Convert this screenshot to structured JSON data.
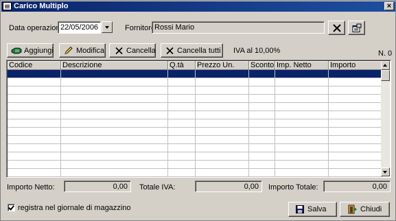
{
  "window": {
    "title": "Carico Multiplo",
    "close_label": "×"
  },
  "header": {
    "date_label": "Data operazione:",
    "date_value": "22/05/2006",
    "supplier_label": "Fornitore:",
    "supplier_value": "Rossi Mario"
  },
  "toolbar": {
    "add_label": "Aggiungi",
    "edit_label": "Modifica",
    "delete_label": "Cancella",
    "delete_all_label": "Cancella tutti",
    "vat_info": "IVA al 10,00%",
    "count": "N. 0"
  },
  "grid": {
    "columns": [
      "Codice",
      "Descrizione",
      "Q.tà",
      "Prezzo Un.",
      "Sconto",
      "Imp. Netto",
      "Importo"
    ],
    "rows": []
  },
  "totals": {
    "net_label": "Importo Netto:",
    "net_value": "0,00",
    "vat_label": "Totale IVA:",
    "vat_value": "0,00",
    "total_label": "Importo Totale:",
    "total_value": "0,00"
  },
  "footer": {
    "register_label": "registra nel giornale di magazzino",
    "register_checked": true,
    "save_label": "Salva",
    "close_label": "Chiudi"
  },
  "icons": {
    "app": "document-icon",
    "add": "add-hand-icon",
    "edit": "pencil-icon",
    "delete": "x-icon",
    "delete_all": "x-icon",
    "clear_supplier": "x-icon",
    "lookup_supplier": "lookup-icon",
    "save": "floppy-icon",
    "close": "exit-door-icon"
  },
  "colors": {
    "selection": "#0a246a",
    "title_bar": "#0a246a",
    "face": "#d4d0c8"
  }
}
